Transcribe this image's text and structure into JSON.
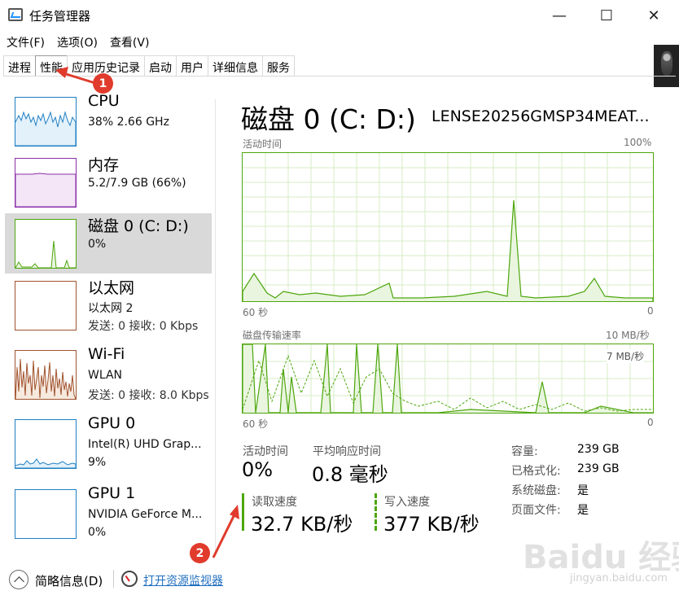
{
  "window": {
    "title": "任务管理器",
    "minimize": "—",
    "maximize": "☐",
    "close": "✕"
  },
  "menu": [
    "文件(F)",
    "选项(O)",
    "查看(V)"
  ],
  "tabs": [
    "进程",
    "性能",
    "应用历史记录",
    "启动",
    "用户",
    "详细信息",
    "服务"
  ],
  "active_tab": 1,
  "sidebar": [
    {
      "name": "CPU",
      "line1": "38% 2.66 GHz",
      "line2": "",
      "color": "#1f7fc2",
      "selected": false
    },
    {
      "name": "内存",
      "line1": "5.2/7.9 GB (66%)",
      "line2": "",
      "color": "#8b2fa8",
      "selected": false
    },
    {
      "name": "磁盘 0 (C: D:)",
      "line1": "0%",
      "line2": "",
      "color": "#4da60c",
      "selected": true
    },
    {
      "name": "以太网",
      "line1": "以太网 2",
      "line2": "发送: 0 接收: 0 Kbps",
      "color": "#a0522d",
      "selected": false
    },
    {
      "name": "Wi-Fi",
      "line1": "WLAN",
      "line2": "发送: 0 接收: 8.0 Kbps",
      "color": "#a0522d",
      "selected": false
    },
    {
      "name": "GPU 0",
      "line1": "Intel(R) UHD Grap...",
      "line2": "9%",
      "color": "#1f7fc2",
      "selected": false
    },
    {
      "name": "GPU 1",
      "line1": "NVIDIA GeForce M...",
      "line2": "0%",
      "color": "#1f7fc2",
      "selected": false
    }
  ],
  "main": {
    "title": "磁盘 0 (C: D:)",
    "model": "LENSE20256GMSP34MEAT...",
    "graph1": {
      "label": "活动时间",
      "max": "100%",
      "time": "60 秒",
      "min": "0"
    },
    "graph2": {
      "label": "磁盘传输速率",
      "max": "10 MB/秒",
      "inner_label": "7 MB/秒",
      "time": "60 秒",
      "min": "0"
    },
    "stats": {
      "active_time_label": "活动时间",
      "active_time": "0%",
      "avg_resp_label": "平均响应时间",
      "avg_resp": "0.8 毫秒",
      "read_label": "读取速度",
      "read": "32.7 KB/秒",
      "write_label": "写入速度",
      "write": "377 KB/秒"
    },
    "info": [
      {
        "k": "容量:",
        "v": "239 GB"
      },
      {
        "k": "已格式化:",
        "v": "239 GB"
      },
      {
        "k": "系统磁盘:",
        "v": "是"
      },
      {
        "k": "页面文件:",
        "v": "是"
      }
    ]
  },
  "footer": {
    "fewer_details": "简略信息(D)",
    "resource_monitor": "打开资源监视器"
  },
  "annotations": {
    "badge1": "1",
    "badge2": "2",
    "color": "#e03b2c"
  },
  "watermark": {
    "main": "Baidu 经验",
    "sub": "jingyan.baidu.com"
  }
}
